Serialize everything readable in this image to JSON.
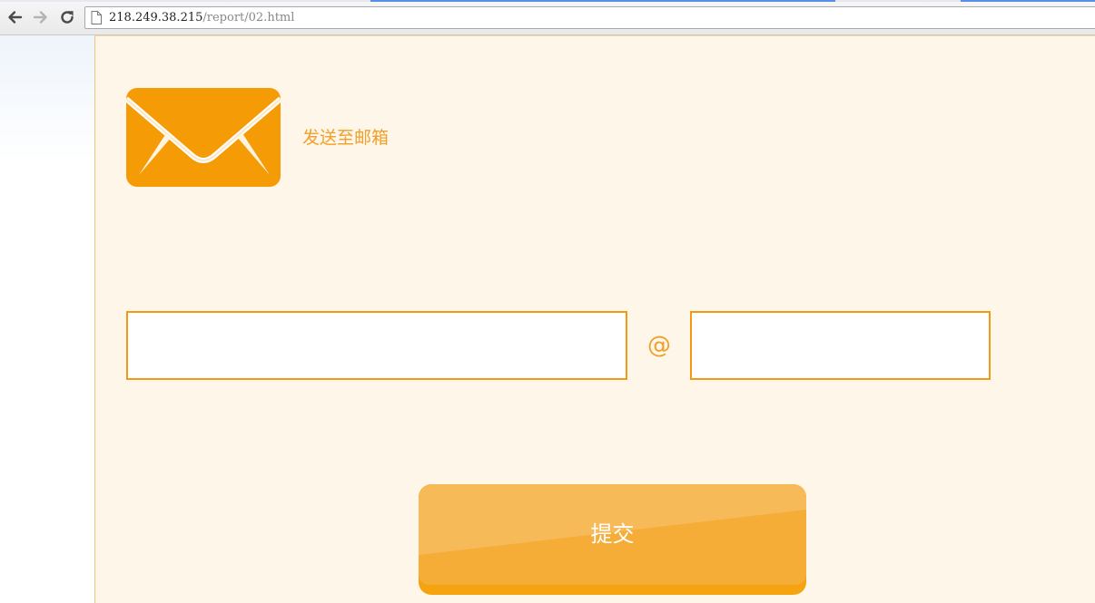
{
  "browser": {
    "url_host": "218.249.38.215",
    "url_path": "/report/02.html",
    "icons": [
      "back-arrow-icon",
      "forward-arrow-icon",
      "reload-icon",
      "page-icon"
    ]
  },
  "form": {
    "send_to_email_label": "发送至邮箱",
    "email_user_value": "",
    "at_symbol": "@",
    "email_domain_value": "",
    "submit_label": "提交",
    "icons": [
      "envelope-icon"
    ]
  },
  "colors": {
    "accent": "#f59b06",
    "label": "#f0a02a",
    "page_background": "#fef6e8",
    "field_border": "#f39a14"
  }
}
